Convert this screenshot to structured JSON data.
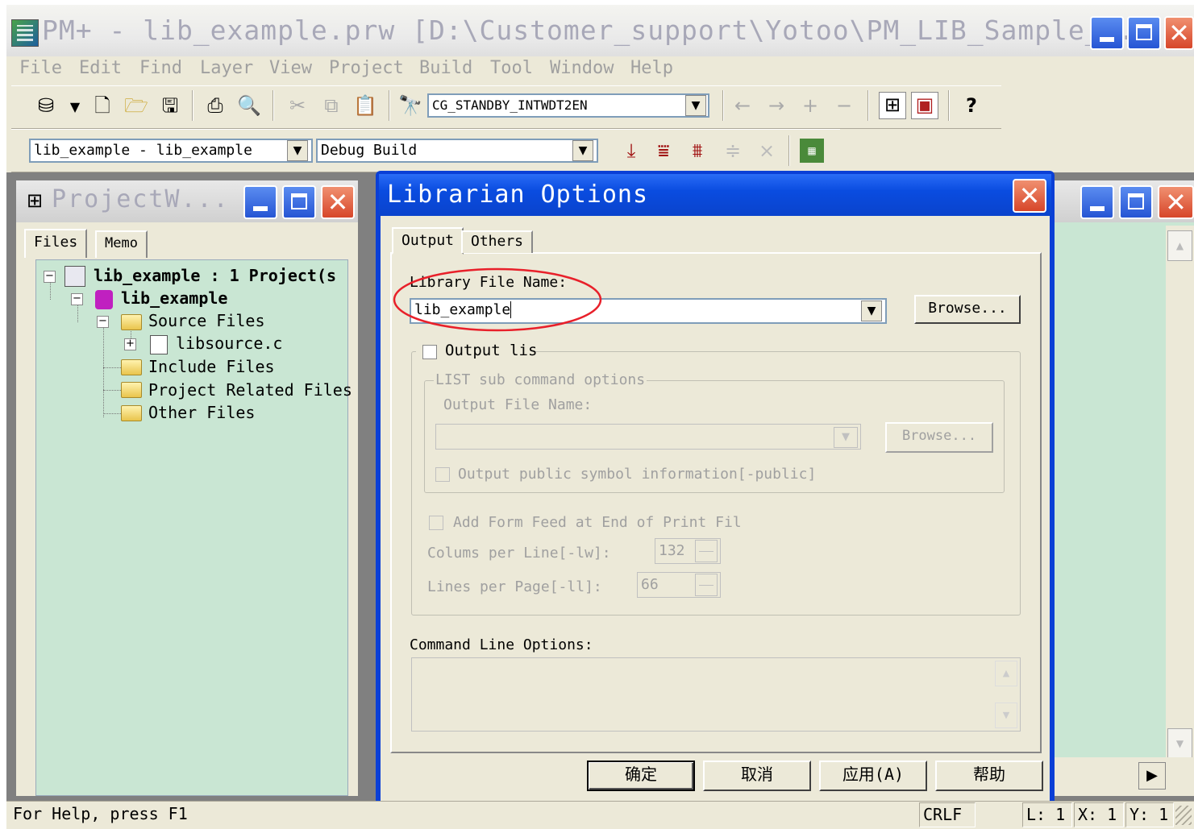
{
  "app": {
    "title": "PM+ - lib_example.prw [D:\\Customer_support\\Yotoo\\PM_LIB_Sample_..."
  },
  "menu": [
    {
      "label": "File"
    },
    {
      "label": "Edit"
    },
    {
      "label": "Find"
    },
    {
      "label": "Layer"
    },
    {
      "label": "View"
    },
    {
      "label": "Project"
    },
    {
      "label": "Build"
    },
    {
      "label": "Tool"
    },
    {
      "label": "Window"
    },
    {
      "label": "Help"
    }
  ],
  "toolbar": {
    "symbol_combo": "CG_STANDBY_INTWDT2EN",
    "project_combo": "lib_example - lib_example",
    "build_combo": "Debug Build",
    "icons": [
      "open-project-icon",
      "new-file-icon",
      "open-file-icon",
      "save-icon",
      "print-icon",
      "print-preview-icon",
      "cut-icon",
      "copy-icon",
      "paste-icon",
      "find-symbol-icon",
      "back-icon",
      "forward-icon",
      "add-bookmark-icon",
      "remove-bookmark-icon",
      "project-window-icon",
      "output-window-icon",
      "help-icon",
      "build-icon",
      "rebuild-icon",
      "build-all-icon",
      "stop-build-icon",
      "clean-icon",
      "debugger-icon"
    ]
  },
  "project_window": {
    "title": "ProjectW...",
    "tabs": [
      "Files",
      "Memo"
    ],
    "tree": [
      {
        "label": "lib_example : 1 Project(s",
        "bold": true
      },
      {
        "label": "lib_example",
        "bold": true
      },
      {
        "label": "Source Files"
      },
      {
        "label": "libsource.c"
      },
      {
        "label": "Include Files"
      },
      {
        "label": "Project Related Files"
      },
      {
        "label": "Other Files"
      }
    ]
  },
  "dialog": {
    "title": "Librarian Options",
    "tabs": [
      "Output",
      "Others"
    ],
    "library_file_name_label": "Library File Name:",
    "library_file_name_value": "lib_example",
    "browse_label": "Browse...",
    "output_list_label": "Output lis",
    "list_group_label": "LIST sub command options",
    "output_file_name_label": "Output File Name:",
    "output_file_name_value": "",
    "browse2_label": "Browse...",
    "public_symbol_label": "Output public symbol information[-public]",
    "form_feed_label": "Add Form Feed at End of Print Fil",
    "columns_label": "Colums per Line[-lw]:",
    "columns_value": "132",
    "lines_label": "Lines per Page[-ll]:",
    "lines_value": "66",
    "command_line_label": "Command Line Options:",
    "command_line_value": "",
    "buttons": {
      "ok": "确定",
      "cancel": "取消",
      "apply": "应用(A)",
      "help": "帮助"
    }
  },
  "status_bar": {
    "help_text": "For Help, press F1",
    "line_ending": "CRLF",
    "line": "L: 1",
    "x": "X: 1",
    "y": "Y: 1"
  },
  "colors": {
    "tree_bg": "#c9e6d3",
    "dialog_title": "#0a4ce0",
    "annotation": "#e8202a"
  }
}
